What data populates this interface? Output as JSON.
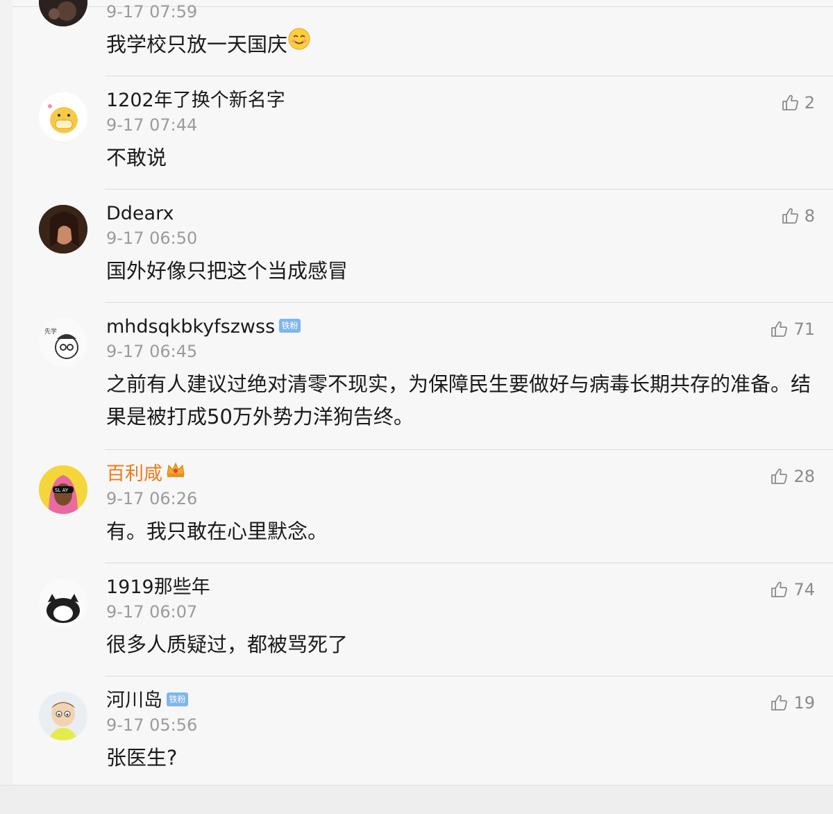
{
  "comments": [
    {
      "username": "",
      "time": "9-17 07:59",
      "text": "我学校只放一天国庆",
      "likes": "",
      "badge": ""
    },
    {
      "username": "1202年了换个新名字",
      "time": "9-17 07:44",
      "text": "不敢说",
      "likes": "2",
      "badge": ""
    },
    {
      "username": "Ddearx",
      "time": "9-17 06:50",
      "text": "国外好像只把这个当成感冒",
      "likes": "8",
      "badge": ""
    },
    {
      "username": "mhdsqkbkyfszwss",
      "time": "9-17 06:45",
      "text": "之前有人建议过绝对清零不现实，为保障民生要做好与病毒长期共存的准备。结果是被打成50万外势力洋狗告终。",
      "likes": "71",
      "badge": "铁粉"
    },
    {
      "username": "百利咸",
      "time": "9-17 06:26",
      "text": "有。我只敢在心里默念。",
      "likes": "28",
      "badge": ""
    },
    {
      "username": "1919那些年",
      "time": "9-17 06:07",
      "text": "很多人质疑过，都被骂死了",
      "likes": "74",
      "badge": ""
    },
    {
      "username": "河川岛",
      "time": "9-17 05:56",
      "text": "张医生?",
      "likes": "19",
      "badge": "铁粉"
    }
  ],
  "icons": {
    "like": "thumbs-up-icon",
    "smile": "smile-emoji-icon",
    "crown": "crown-icon"
  },
  "colors": {
    "vip_name": "#f07a18",
    "badge_bg": "#7eb6ec",
    "meta_text": "#9b9b9b"
  }
}
